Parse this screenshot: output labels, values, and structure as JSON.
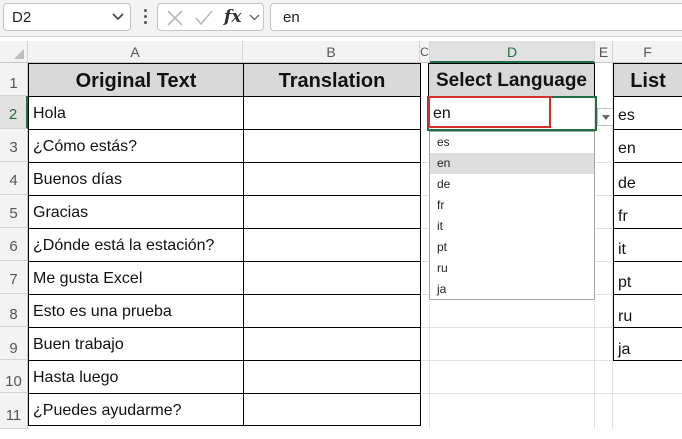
{
  "formula_bar": {
    "name_box": "D2",
    "formula": "en",
    "fx_label": "fx",
    "icons": [
      "chevron-down-icon",
      "more-vertical-icon",
      "cancel-x-icon",
      "confirm-check-icon",
      "fx-icon"
    ]
  },
  "columns": [
    "A",
    "B",
    "C",
    "D",
    "E",
    "F"
  ],
  "rows": [
    "1",
    "2",
    "3",
    "4",
    "5",
    "6",
    "7",
    "8",
    "9",
    "10",
    "11"
  ],
  "table": {
    "headers": {
      "original": "Original Text",
      "translation": "Translation"
    },
    "original_texts": [
      "Hola",
      "¿Cómo estás?",
      "Buenos días",
      "Gracias",
      "¿Dónde está la estación?",
      "Me gusta Excel",
      "Esto es una prueba",
      "Buen trabajo",
      "Hasta luego",
      "¿Puedes ayudarme?"
    ]
  },
  "select_language": {
    "header": "Select Language",
    "value": "en"
  },
  "dropdown": {
    "options": [
      "es",
      "en",
      "de",
      "fr",
      "it",
      "pt",
      "ru",
      "ja"
    ],
    "selected": "en"
  },
  "list": {
    "header": "List",
    "items": [
      "es",
      "en",
      "de",
      "fr",
      "it",
      "pt",
      "ru",
      "ja"
    ]
  },
  "colors": {
    "selection_green": "#1f6f43",
    "highlight_red": "#d0312d",
    "header_fill": "#d9d9d9"
  }
}
